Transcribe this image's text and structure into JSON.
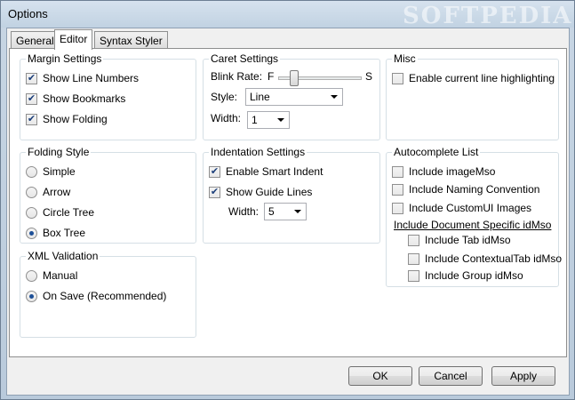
{
  "window": {
    "title": "Options",
    "watermark": "SOFTPEDIA"
  },
  "tabs": [
    {
      "label": "General"
    },
    {
      "label": "Editor"
    },
    {
      "label": "Syntax Styler"
    }
  ],
  "margin_settings": {
    "label": "Margin Settings",
    "items": [
      {
        "label": "Show Line Numbers",
        "checked": true
      },
      {
        "label": "Show Bookmarks",
        "checked": true
      },
      {
        "label": "Show Folding",
        "checked": true
      }
    ]
  },
  "caret_settings": {
    "label": "Caret Settings",
    "blink_rate_label": "Blink Rate:",
    "slider_min_label": "F",
    "slider_max_label": "S",
    "slider_value": 0.15,
    "style_label": "Style:",
    "style_value": "Line",
    "width_label": "Width:",
    "width_value": "1"
  },
  "misc": {
    "label": "Misc",
    "items": [
      {
        "label": "Enable current line highlighting",
        "checked": false
      }
    ]
  },
  "folding_style": {
    "label": "Folding Style",
    "options": [
      {
        "label": "Simple",
        "selected": false
      },
      {
        "label": "Arrow",
        "selected": false
      },
      {
        "label": "Circle Tree",
        "selected": false
      },
      {
        "label": "Box Tree",
        "selected": true
      }
    ]
  },
  "indentation_settings": {
    "label": "Indentation Settings",
    "items": [
      {
        "label": "Enable Smart Indent",
        "checked": true
      },
      {
        "label": "Show Guide Lines",
        "checked": true
      }
    ],
    "width_label": "Width:",
    "width_value": "5"
  },
  "autocomplete_list": {
    "label": "Autocomplete List",
    "items": [
      {
        "label": "Include imageMso",
        "checked": false
      },
      {
        "label": "Include Naming Convention",
        "checked": false
      },
      {
        "label": "Include CustomUI Images",
        "checked": false
      }
    ],
    "doc_specific_label": "Include Document Specific idMso",
    "doc_specific_items": [
      {
        "label": "Include Tab idMso",
        "checked": false
      },
      {
        "label": "Include ContextualTab idMso",
        "checked": false
      },
      {
        "label": "Include Group idMso",
        "checked": false
      }
    ]
  },
  "xml_validation": {
    "label": "XML Validation",
    "options": [
      {
        "label": "Manual",
        "selected": false
      },
      {
        "label": "On Save (Recommended)",
        "selected": true
      }
    ]
  },
  "buttons": {
    "ok": "OK",
    "cancel": "Cancel",
    "apply": "Apply"
  },
  "colors": {
    "accent": "#1d4f97",
    "check": "#1c3f7a",
    "frame": "#b9cadb"
  }
}
